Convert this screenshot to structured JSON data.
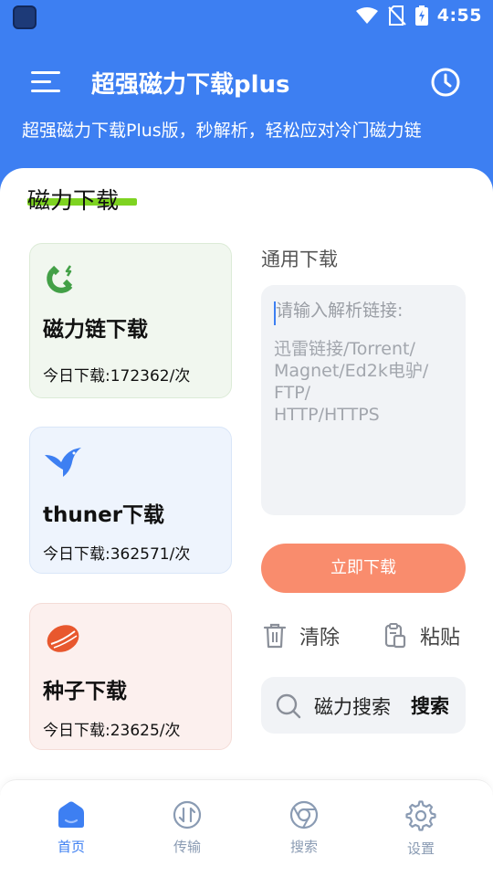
{
  "status_bar": {
    "time": "4:55",
    "icons": [
      "app-icon",
      "wifi-icon",
      "no-sim-icon",
      "battery-charging-icon"
    ]
  },
  "app_bar": {
    "title": "超强磁力下载plus",
    "menu_icon": "menu-icon",
    "history_icon": "clock-icon"
  },
  "subtitle": "超强磁力下载Plus版，秒解析，轻松应对冷门磁力链",
  "section": {
    "title": "磁力下载"
  },
  "colors": {
    "primary": "#3d7ff2",
    "accent_green": "#7ed321",
    "download_button": "#f98c6d"
  },
  "cards": [
    {
      "name": "磁力链下载",
      "count": "今日下载:172362/次",
      "icon": "magnet-icon",
      "icon_color": "#43a047"
    },
    {
      "name": "thuner下载",
      "count": "今日下载:362571/次",
      "icon": "bird-icon",
      "icon_color": "#3d7ff2"
    },
    {
      "name": "种子下载",
      "count": "今日下载:23625/次",
      "icon": "seed-icon",
      "icon_color": "#e8582e"
    }
  ],
  "general": {
    "label": "通用下载",
    "input_placeholder": "请输入解析链接:",
    "input_hint": "迅雷链接/Torrent/\nMagnet/Ed2k电驴/\nFTP/\nHTTP/HTTPS",
    "download_label": "立即下载",
    "clear_label": "清除",
    "paste_label": "粘贴",
    "search_text": "磁力搜索",
    "search_button": "搜索"
  },
  "bottom_nav": {
    "items": [
      {
        "label": "首页",
        "icon": "home-icon",
        "active": true
      },
      {
        "label": "传输",
        "icon": "transfer-icon",
        "active": false
      },
      {
        "label": "搜索",
        "icon": "browser-icon",
        "active": false
      },
      {
        "label": "设置",
        "icon": "settings-icon",
        "active": false
      }
    ]
  }
}
